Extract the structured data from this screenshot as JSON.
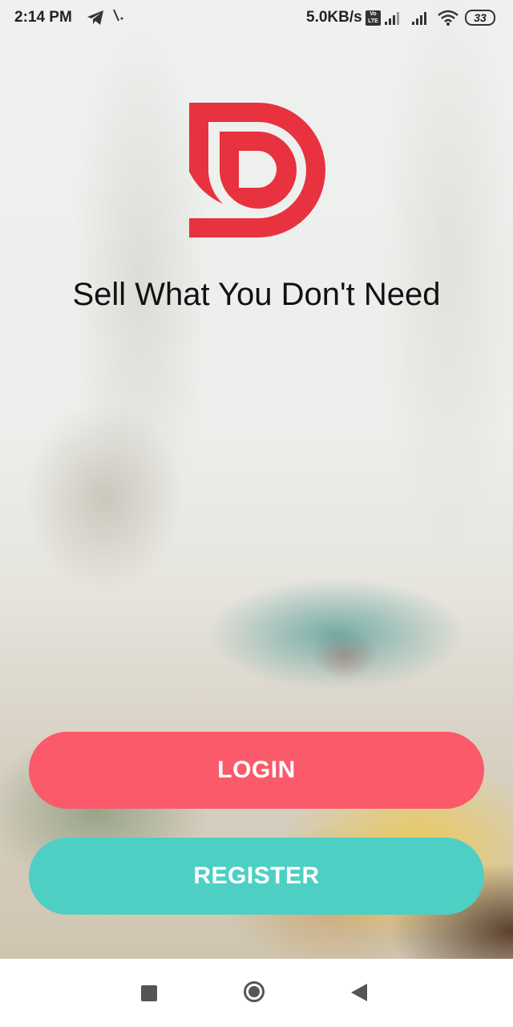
{
  "status_bar": {
    "time": "2:14 PM",
    "network_speed": "5.0KB/s",
    "lte_badge": "Vo LTE",
    "battery": "33"
  },
  "tagline": "Sell What You Don't Need",
  "buttons": {
    "login": "LOGIN",
    "register": "REGISTER"
  },
  "colors": {
    "brand_red": "#e8323f",
    "login_bg": "#fa5a69",
    "register_bg": "#4ecfc4"
  },
  "icons": {
    "status": [
      "telegram-icon",
      "vpn-icon",
      "signal-icon",
      "signal-icon",
      "wifi-icon",
      "battery-icon"
    ],
    "nav": [
      "recent-apps-icon",
      "home-icon",
      "back-icon"
    ]
  }
}
